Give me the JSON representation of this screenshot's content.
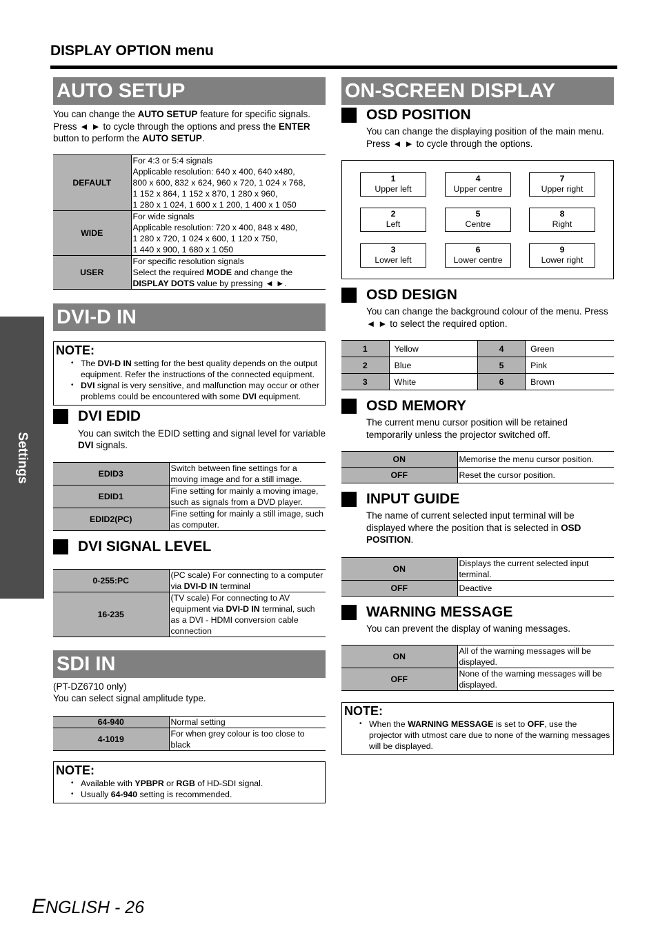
{
  "header": {
    "title": "DISPLAY OPTION menu"
  },
  "side_tab": {
    "label": "Settings"
  },
  "auto_setup": {
    "title": "AUTO SETUP",
    "intro": [
      {
        "t": "You can change the "
      },
      {
        "t": "AUTO SETUP",
        "b": true
      },
      {
        "t": " feature for specific signals. Press ◄ ► to cycle through the options and press the "
      },
      {
        "t": "ENTER",
        "b": true
      },
      {
        "t": " button to perform the "
      },
      {
        "t": "AUTO SETUP",
        "b": true
      },
      {
        "t": "."
      }
    ],
    "rows": [
      {
        "key": "DEFAULT",
        "lines": [
          "For 4:3 or 5:4 signals",
          "Applicable resolution: 640 x 400, 640 x480,",
          "800 x 600, 832 x 624, 960 x 720, 1 024 x 768,",
          "1 152 x 864, 1 152 x 870, 1 280 x 960,",
          "1 280 x 1 024, 1 600 x 1 200, 1 400 x 1 050"
        ]
      },
      {
        "key": "WIDE",
        "lines": [
          "For wide signals",
          "Applicable resolution: 720 x 400, 848 x 480,",
          "1 280 x 720, 1 024 x 600, 1 120 x 750,",
          "1 440 x 900, 1 680 x 1 050"
        ]
      },
      {
        "key": "USER",
        "rich": [
          {
            "t": "For specific resolution signals"
          },
          {
            "br": true
          },
          {
            "t": "Select the required "
          },
          {
            "t": "MODE",
            "b": true
          },
          {
            "t": " and change the"
          },
          {
            "br": true
          },
          {
            "t": "DISPLAY DOTS",
            "b": true
          },
          {
            "t": " value by pressing ◄ ►."
          }
        ]
      }
    ]
  },
  "dvi_d_in": {
    "title": "DVI-D IN",
    "note": {
      "title": "NOTE:",
      "items": [
        [
          {
            "t": "The "
          },
          {
            "t": "DVI-D IN",
            "b": true
          },
          {
            "t": " setting for the best quality depends on the output equipment. Refer the instructions of the connected equipment."
          }
        ],
        [
          {
            "t": "DVI",
            "b": true
          },
          {
            "t": " signal is very sensitive, and malfunction may occur or other problems could be encountered with some "
          },
          {
            "t": "DVI",
            "b": true
          },
          {
            "t": " equipment."
          }
        ]
      ]
    },
    "edid": {
      "title": "DVI EDID",
      "intro": [
        {
          "t": "You can switch the EDID setting and signal level for variable "
        },
        {
          "t": "DVI",
          "b": true
        },
        {
          "t": " signals."
        }
      ],
      "rows": [
        {
          "key": "EDID3",
          "text": "Switch between fine settings for a moving image and for a still image."
        },
        {
          "key": "EDID1",
          "text": "Fine setting for mainly a moving image, such as signals from a DVD player."
        },
        {
          "key": "EDID2(PC)",
          "text": "Fine setting for mainly a still image, such as computer."
        }
      ]
    },
    "signal_level": {
      "title": "DVI SIGNAL LEVEL",
      "rows": [
        {
          "key": "0-255:PC",
          "rich": [
            {
              "t": "(PC scale) For connecting to a computer via "
            },
            {
              "t": "DVI-D IN",
              "b": true
            },
            {
              "t": " terminal"
            }
          ]
        },
        {
          "key": "16-235",
          "rich": [
            {
              "t": "(TV scale) For connecting to AV equipment via "
            },
            {
              "t": "DVI-D IN",
              "b": true
            },
            {
              "t": " terminal, such as a DVI - HDMI conversion cable connection"
            }
          ]
        }
      ]
    }
  },
  "sdi_in": {
    "title": "SDI IN",
    "model_note": "(PT-DZ6710 only)",
    "intro": "You can select signal amplitude type.",
    "rows": [
      {
        "key": "64-940",
        "text": "Normal setting"
      },
      {
        "key": "4-1019",
        "text": "For when grey colour is too close to black"
      }
    ],
    "note": {
      "title": "NOTE:",
      "items": [
        [
          {
            "t": "Available with "
          },
          {
            "t": "YPBPR",
            "b": true
          },
          {
            "t": " or "
          },
          {
            "t": "RGB",
            "b": true
          },
          {
            "t": " of HD-SDI signal."
          }
        ],
        [
          {
            "t": "Usually "
          },
          {
            "t": "64-940",
            "b": true
          },
          {
            "t": " setting is recommended."
          }
        ]
      ]
    }
  },
  "on_screen_display": {
    "title": "ON-SCREEN DISPLAY",
    "osd_position": {
      "title": "OSD POSITION",
      "intro": "You can change the displaying position of the main menu. Press ◄ ► to cycle through the options.",
      "positions": [
        {
          "num": "1",
          "label": "Upper left"
        },
        {
          "num": "4",
          "label": "Upper centre"
        },
        {
          "num": "7",
          "label": "Upper right"
        },
        {
          "num": "2",
          "label": "Left"
        },
        {
          "num": "5",
          "label": "Centre"
        },
        {
          "num": "8",
          "label": "Right"
        },
        {
          "num": "3",
          "label": "Lower left"
        },
        {
          "num": "6",
          "label": "Lower centre"
        },
        {
          "num": "9",
          "label": "Lower right"
        }
      ]
    },
    "osd_design": {
      "title": "OSD DESIGN",
      "intro": "You can change the background colour of the menu. Press ◄ ► to select the required option.",
      "rows": [
        [
          {
            "num": "1",
            "color": "Yellow"
          },
          {
            "num": "4",
            "color": "Green"
          }
        ],
        [
          {
            "num": "2",
            "color": "Blue"
          },
          {
            "num": "5",
            "color": "Pink"
          }
        ],
        [
          {
            "num": "3",
            "color": "White"
          },
          {
            "num": "6",
            "color": "Brown"
          }
        ]
      ]
    },
    "osd_memory": {
      "title": "OSD MEMORY",
      "intro": "The current menu cursor position will be retained temporarily unless the projector switched off.",
      "rows": [
        {
          "key": "ON",
          "text": "Memorise the menu cursor position."
        },
        {
          "key": "OFF",
          "text": "Reset the cursor position."
        }
      ]
    },
    "input_guide": {
      "title": "INPUT GUIDE",
      "intro": [
        {
          "t": "The name of current selected input terminal will be displayed where the position that is selected in "
        },
        {
          "t": "OSD POSITION",
          "b": true
        },
        {
          "t": "."
        }
      ],
      "rows": [
        {
          "key": "ON",
          "text": "Displays the current selected input terminal."
        },
        {
          "key": "OFF",
          "text": "Deactive"
        }
      ]
    },
    "warning_message": {
      "title": "WARNING MESSAGE",
      "intro": "You can prevent the display of waning messages.",
      "rows": [
        {
          "key": "ON",
          "text": "All of the warning messages will be displayed."
        },
        {
          "key": "OFF",
          "text": "None of the warning messages will be displayed."
        }
      ],
      "note": {
        "title": "NOTE:",
        "items": [
          [
            {
              "t": "When the "
            },
            {
              "t": "WARNING MESSAGE",
              "b": true
            },
            {
              "t": " is set to "
            },
            {
              "t": "OFF",
              "b": true
            },
            {
              "t": ", use the projector with utmost care due to none of the warning messages will be displayed."
            }
          ]
        ]
      }
    }
  },
  "footer": {
    "first_letter": "E",
    "rest": "NGLISH - 26"
  },
  "colors": {
    "section_bar": "#808080",
    "key_cell": "#b3b3b3",
    "side_tab": "#4d4d4d"
  }
}
